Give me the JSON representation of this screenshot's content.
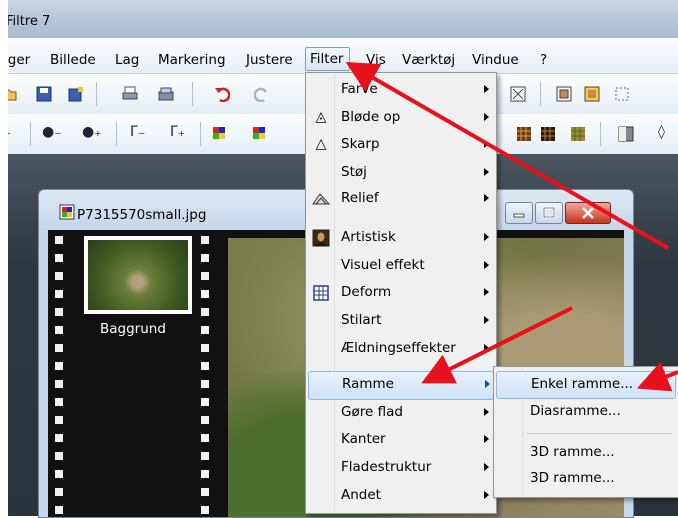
{
  "window": {
    "title": "Filtre 7"
  },
  "menubar": {
    "items": [
      {
        "label": "iger"
      },
      {
        "label": "Billede"
      },
      {
        "label": "Lag"
      },
      {
        "label": "Markering"
      },
      {
        "label": "Justere"
      },
      {
        "label": "Filter"
      },
      {
        "label": "Vis"
      },
      {
        "label": "Værktøj"
      },
      {
        "label": "Vindue"
      },
      {
        "label": "?"
      }
    ]
  },
  "image_window": {
    "title": "P7315570small.jpg",
    "layer_label": "Baggrund"
  },
  "filter_menu": {
    "items": [
      {
        "label": "Farve",
        "icon": "none",
        "submenu": true
      },
      {
        "label": "Bløde op",
        "icon": "drop-icon",
        "submenu": true
      },
      {
        "label": "Skarp",
        "icon": "triangle-icon",
        "submenu": true
      },
      {
        "label": "Støj",
        "icon": "none",
        "submenu": true
      },
      {
        "label": "Relief",
        "icon": "relief-icon",
        "submenu": true
      },
      {
        "label": "Artistisk",
        "icon": "mona-lisa-icon",
        "submenu": true
      },
      {
        "label": "Visuel effekt",
        "icon": "none",
        "submenu": true
      },
      {
        "label": "Deform",
        "icon": "grid-icon",
        "submenu": true
      },
      {
        "label": "Stilart",
        "icon": "none",
        "submenu": true
      },
      {
        "label": "Ældningseffekter",
        "icon": "none",
        "submenu": true
      },
      {
        "label": "Ramme",
        "icon": "none",
        "submenu": true,
        "highlighted": true
      },
      {
        "label": "Gøre flad",
        "icon": "none",
        "submenu": true
      },
      {
        "label": "Kanter",
        "icon": "none",
        "submenu": true
      },
      {
        "label": "Fladestruktur",
        "icon": "none",
        "submenu": true
      },
      {
        "label": "Andet",
        "icon": "none",
        "submenu": true
      }
    ]
  },
  "ramme_submenu": {
    "items": [
      {
        "label": "Enkel ramme...",
        "highlighted": true
      },
      {
        "label": "Diasramme..."
      },
      {
        "label": "3D ramme..."
      },
      {
        "label": "3D ramme..."
      }
    ]
  },
  "colors": {
    "annotation_arrow": "#e8101a",
    "menu_highlight": "#cfe2f7",
    "workspace": "#2f3740"
  }
}
